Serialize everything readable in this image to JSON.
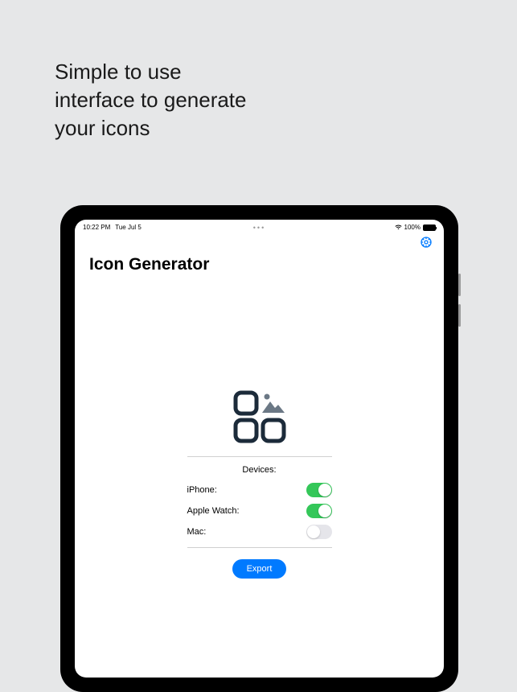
{
  "headline": "Simple to use\ninterface to generate\nyour icons",
  "status": {
    "time": "10:22 PM",
    "date": "Tue Jul 5",
    "battery": "100%"
  },
  "app": {
    "title": "Icon Generator"
  },
  "devices": {
    "section_label": "Devices:",
    "items": [
      {
        "label": "iPhone:",
        "on": true
      },
      {
        "label": "Apple Watch:",
        "on": true
      },
      {
        "label": "Mac:",
        "on": false
      }
    ]
  },
  "export_label": "Export"
}
